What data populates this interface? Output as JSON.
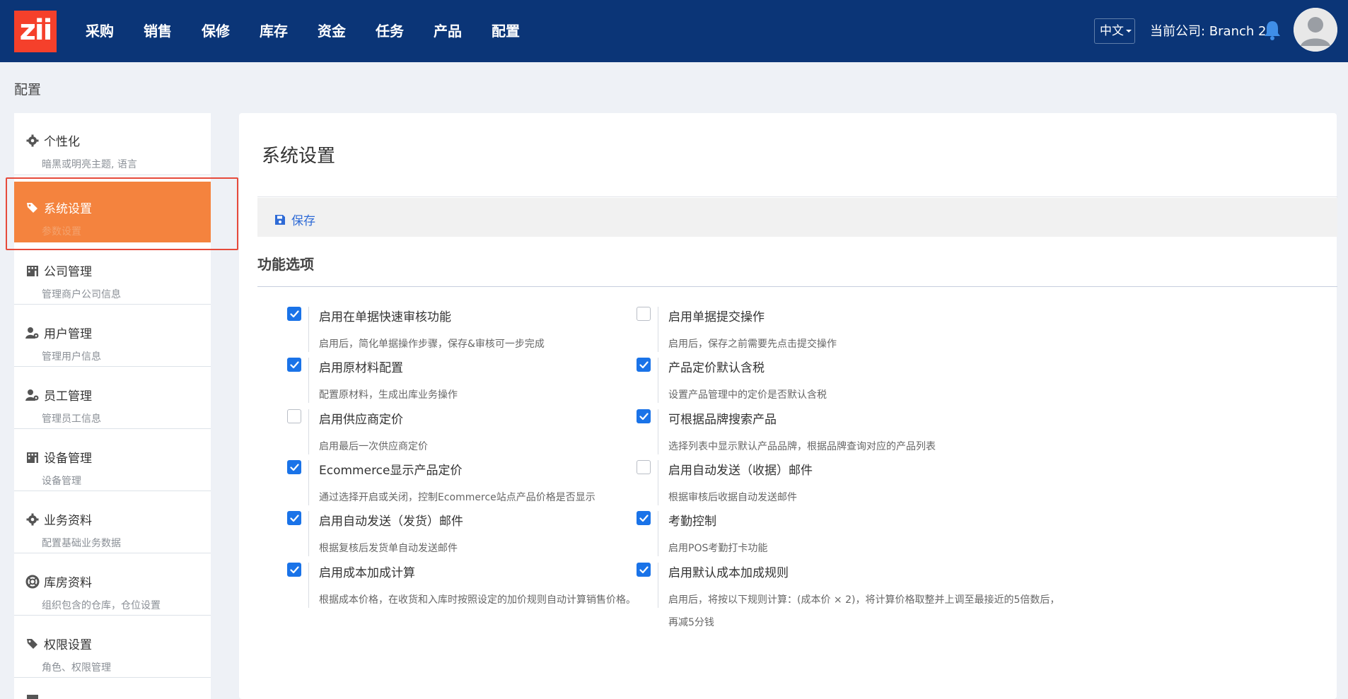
{
  "header": {
    "logo_text": "zii",
    "nav": [
      "采购",
      "销售",
      "保修",
      "库存",
      "资金",
      "任务",
      "产品",
      "配置"
    ],
    "language": "中文",
    "company": "当前公司: Branch 2"
  },
  "page_title": "配置",
  "sidebar": {
    "items": [
      {
        "label": "个性化",
        "sub": "暗黑或明亮主题, 语言",
        "icon": "gear-icon"
      },
      {
        "label": "系统设置",
        "sub": "参数设置",
        "icon": "tags-icon",
        "active": true
      },
      {
        "label": "公司管理",
        "sub": "管理商户公司信息",
        "icon": "building-icon"
      },
      {
        "label": "用户管理",
        "sub": "管理用户信息",
        "icon": "user-gear-icon"
      },
      {
        "label": "员工管理",
        "sub": "管理员工信息",
        "icon": "user-gear-icon"
      },
      {
        "label": "设备管理",
        "sub": "设备管理",
        "icon": "building-icon"
      },
      {
        "label": "业务资料",
        "sub": "配置基础业务数据",
        "icon": "gear-icon"
      },
      {
        "label": "库房资料",
        "sub": "组织包含的仓库，仓位设置",
        "icon": "lifebuoy-icon"
      },
      {
        "label": "权限设置",
        "sub": "角色、权限管理",
        "icon": "tags-icon"
      }
    ]
  },
  "main": {
    "title": "系统设置",
    "save_label": "保存",
    "section_title": "功能选项",
    "options": [
      {
        "label": "启用在单据快速审核功能",
        "desc": "启用后，简化单据操作步骤，保存&审核可一步完成",
        "checked": true
      },
      {
        "label": "启用单据提交操作",
        "desc": "启用后，保存之前需要先点击提交操作",
        "checked": false
      },
      {
        "label": "启用原材料配置",
        "desc": "配置原材料，生成出库业务操作",
        "checked": true
      },
      {
        "label": "产品定价默认含税",
        "desc": "设置产品管理中的定价是否默认含税",
        "checked": true
      },
      {
        "label": "启用供应商定价",
        "desc": "启用最后一次供应商定价",
        "checked": false
      },
      {
        "label": "可根据品牌搜索产品",
        "desc": "选择列表中显示默认产品品牌，根据品牌查询对应的产品列表",
        "checked": true
      },
      {
        "label": "Ecommerce显示产品定价",
        "desc": "通过选择开启或关闭，控制Ecommerce站点产品价格是否显示",
        "checked": true
      },
      {
        "label": "启用自动发送（收据）邮件",
        "desc": "根据审核后收据自动发送邮件",
        "checked": false
      },
      {
        "label": "启用自动发送（发货）邮件",
        "desc": "根据复核后发货单自动发送邮件",
        "checked": true
      },
      {
        "label": "考勤控制",
        "desc": "启用POS考勤打卡功能",
        "checked": true
      },
      {
        "label": "启用成本加成计算",
        "desc": "根据成本价格，在收货和入库时按照设定的加价规则自动计算销售价格。",
        "checked": true
      },
      {
        "label": "启用默认成本加成规则",
        "desc": "启用后，将按以下规则计算：(成本价 × 2)，将计算价格取整并上调至最接近的5倍数后，再减5分钱",
        "checked": true
      }
    ]
  },
  "colors": {
    "topbar": "#0b3577",
    "accent_orange": "#f4833e",
    "checkbox_blue": "#1a73e8",
    "highlight_red": "#e64a3b"
  }
}
